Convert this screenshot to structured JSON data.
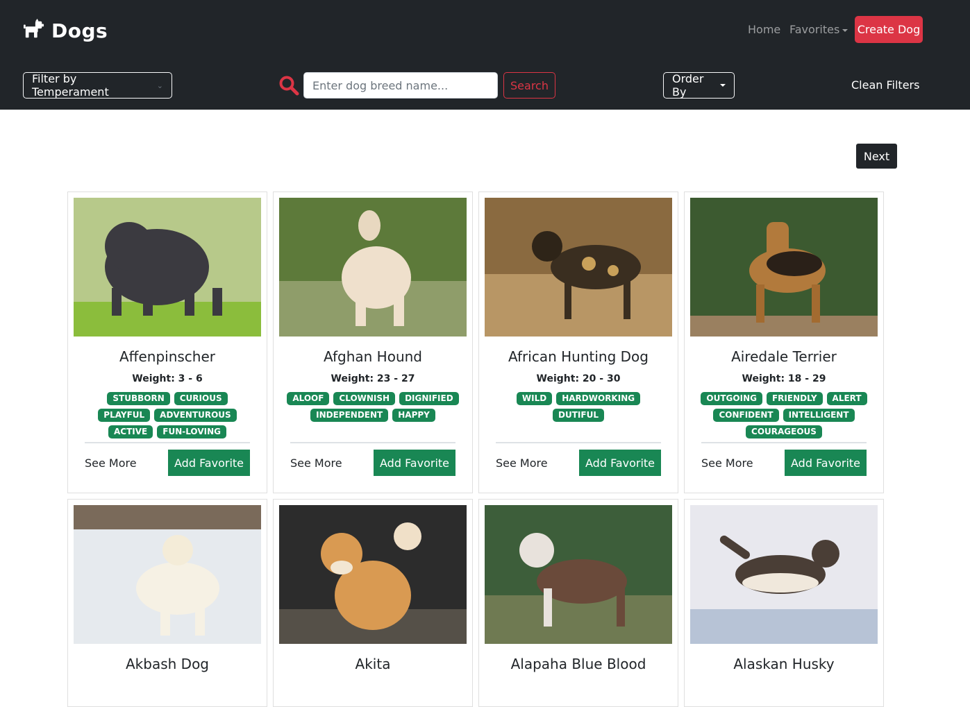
{
  "brand": {
    "title": "Dogs"
  },
  "nav": {
    "home": "Home",
    "favorites": "Favorites",
    "create": "Create Dog"
  },
  "filters": {
    "temperament": "Filter by Temperament",
    "search_placeholder": "Enter dog breed name...",
    "search_button": "Search",
    "order_by": "Order By",
    "clean": "Clean Filters"
  },
  "pagination": {
    "next": "Next"
  },
  "card_actions": {
    "see_more": "See More",
    "add_favorite": "Add Favorite"
  },
  "dogs": [
    {
      "name": "Affenpinscher",
      "weight": "Weight: 3 - 6",
      "temperaments": [
        "STUBBORN",
        "CURIOUS",
        "PLAYFUL",
        "ADVENTUROUS",
        "ACTIVE",
        "FUN-LOVING"
      ]
    },
    {
      "name": "Afghan Hound",
      "weight": "Weight: 23 - 27",
      "temperaments": [
        "ALOOF",
        "CLOWNISH",
        "DIGNIFIED",
        "INDEPENDENT",
        "HAPPY"
      ]
    },
    {
      "name": "African Hunting Dog",
      "weight": "Weight: 20 - 30",
      "temperaments": [
        "WILD",
        "HARDWORKING",
        "DUTIFUL"
      ]
    },
    {
      "name": "Airedale Terrier",
      "weight": "Weight: 18 - 29",
      "temperaments": [
        "OUTGOING",
        "FRIENDLY",
        "ALERT",
        "CONFIDENT",
        "INTELLIGENT",
        "COURAGEOUS"
      ]
    },
    {
      "name": "Akbash Dog"
    },
    {
      "name": "Akita"
    },
    {
      "name": "Alapaha Blue Blood"
    },
    {
      "name": "Alaskan Husky"
    }
  ],
  "colors": {
    "navbar": "#212529",
    "danger": "#dc3545",
    "success": "#198754"
  },
  "icons": {
    "brand": "dog-icon",
    "search": "magnifying-glass-icon"
  }
}
